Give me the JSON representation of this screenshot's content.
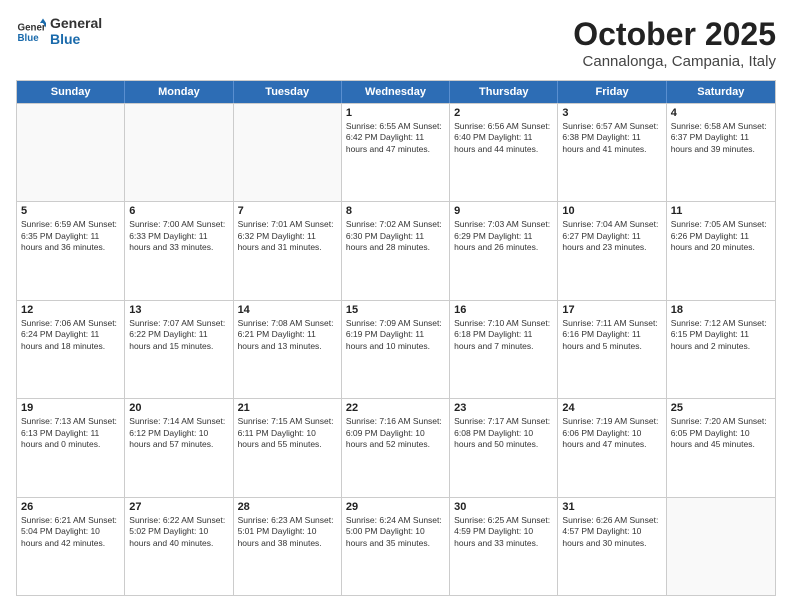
{
  "header": {
    "logo_general": "General",
    "logo_blue": "Blue",
    "title": "October 2025",
    "subtitle": "Cannalonga, Campania, Italy"
  },
  "weekdays": [
    "Sunday",
    "Monday",
    "Tuesday",
    "Wednesday",
    "Thursday",
    "Friday",
    "Saturday"
  ],
  "rows": [
    [
      {
        "day": "",
        "text": ""
      },
      {
        "day": "",
        "text": ""
      },
      {
        "day": "",
        "text": ""
      },
      {
        "day": "1",
        "text": "Sunrise: 6:55 AM\nSunset: 6:42 PM\nDaylight: 11 hours and 47 minutes."
      },
      {
        "day": "2",
        "text": "Sunrise: 6:56 AM\nSunset: 6:40 PM\nDaylight: 11 hours and 44 minutes."
      },
      {
        "day": "3",
        "text": "Sunrise: 6:57 AM\nSunset: 6:38 PM\nDaylight: 11 hours and 41 minutes."
      },
      {
        "day": "4",
        "text": "Sunrise: 6:58 AM\nSunset: 6:37 PM\nDaylight: 11 hours and 39 minutes."
      }
    ],
    [
      {
        "day": "5",
        "text": "Sunrise: 6:59 AM\nSunset: 6:35 PM\nDaylight: 11 hours and 36 minutes."
      },
      {
        "day": "6",
        "text": "Sunrise: 7:00 AM\nSunset: 6:33 PM\nDaylight: 11 hours and 33 minutes."
      },
      {
        "day": "7",
        "text": "Sunrise: 7:01 AM\nSunset: 6:32 PM\nDaylight: 11 hours and 31 minutes."
      },
      {
        "day": "8",
        "text": "Sunrise: 7:02 AM\nSunset: 6:30 PM\nDaylight: 11 hours and 28 minutes."
      },
      {
        "day": "9",
        "text": "Sunrise: 7:03 AM\nSunset: 6:29 PM\nDaylight: 11 hours and 26 minutes."
      },
      {
        "day": "10",
        "text": "Sunrise: 7:04 AM\nSunset: 6:27 PM\nDaylight: 11 hours and 23 minutes."
      },
      {
        "day": "11",
        "text": "Sunrise: 7:05 AM\nSunset: 6:26 PM\nDaylight: 11 hours and 20 minutes."
      }
    ],
    [
      {
        "day": "12",
        "text": "Sunrise: 7:06 AM\nSunset: 6:24 PM\nDaylight: 11 hours and 18 minutes."
      },
      {
        "day": "13",
        "text": "Sunrise: 7:07 AM\nSunset: 6:22 PM\nDaylight: 11 hours and 15 minutes."
      },
      {
        "day": "14",
        "text": "Sunrise: 7:08 AM\nSunset: 6:21 PM\nDaylight: 11 hours and 13 minutes."
      },
      {
        "day": "15",
        "text": "Sunrise: 7:09 AM\nSunset: 6:19 PM\nDaylight: 11 hours and 10 minutes."
      },
      {
        "day": "16",
        "text": "Sunrise: 7:10 AM\nSunset: 6:18 PM\nDaylight: 11 hours and 7 minutes."
      },
      {
        "day": "17",
        "text": "Sunrise: 7:11 AM\nSunset: 6:16 PM\nDaylight: 11 hours and 5 minutes."
      },
      {
        "day": "18",
        "text": "Sunrise: 7:12 AM\nSunset: 6:15 PM\nDaylight: 11 hours and 2 minutes."
      }
    ],
    [
      {
        "day": "19",
        "text": "Sunrise: 7:13 AM\nSunset: 6:13 PM\nDaylight: 11 hours and 0 minutes."
      },
      {
        "day": "20",
        "text": "Sunrise: 7:14 AM\nSunset: 6:12 PM\nDaylight: 10 hours and 57 minutes."
      },
      {
        "day": "21",
        "text": "Sunrise: 7:15 AM\nSunset: 6:11 PM\nDaylight: 10 hours and 55 minutes."
      },
      {
        "day": "22",
        "text": "Sunrise: 7:16 AM\nSunset: 6:09 PM\nDaylight: 10 hours and 52 minutes."
      },
      {
        "day": "23",
        "text": "Sunrise: 7:17 AM\nSunset: 6:08 PM\nDaylight: 10 hours and 50 minutes."
      },
      {
        "day": "24",
        "text": "Sunrise: 7:19 AM\nSunset: 6:06 PM\nDaylight: 10 hours and 47 minutes."
      },
      {
        "day": "25",
        "text": "Sunrise: 7:20 AM\nSunset: 6:05 PM\nDaylight: 10 hours and 45 minutes."
      }
    ],
    [
      {
        "day": "26",
        "text": "Sunrise: 6:21 AM\nSunset: 5:04 PM\nDaylight: 10 hours and 42 minutes."
      },
      {
        "day": "27",
        "text": "Sunrise: 6:22 AM\nSunset: 5:02 PM\nDaylight: 10 hours and 40 minutes."
      },
      {
        "day": "28",
        "text": "Sunrise: 6:23 AM\nSunset: 5:01 PM\nDaylight: 10 hours and 38 minutes."
      },
      {
        "day": "29",
        "text": "Sunrise: 6:24 AM\nSunset: 5:00 PM\nDaylight: 10 hours and 35 minutes."
      },
      {
        "day": "30",
        "text": "Sunrise: 6:25 AM\nSunset: 4:59 PM\nDaylight: 10 hours and 33 minutes."
      },
      {
        "day": "31",
        "text": "Sunrise: 6:26 AM\nSunset: 4:57 PM\nDaylight: 10 hours and 30 minutes."
      },
      {
        "day": "",
        "text": ""
      }
    ]
  ]
}
